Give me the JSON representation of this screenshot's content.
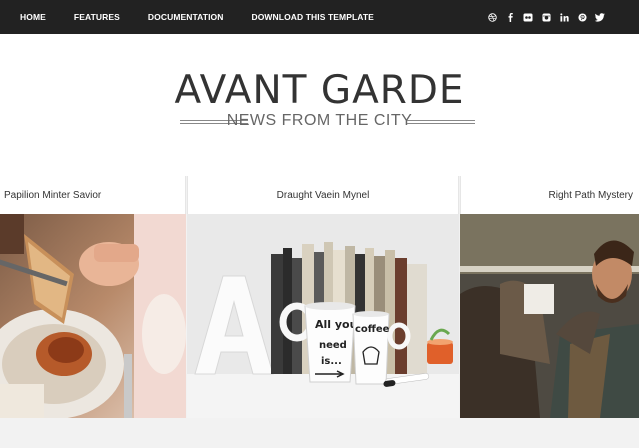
{
  "nav": {
    "items": [
      "HOME",
      "FEATURES",
      "DOCUMENTATION",
      "DOWNLOAD THIS TEMPLATE"
    ]
  },
  "social": {
    "icons": [
      "dribbble-icon",
      "facebook-icon",
      "flickr-icon",
      "instagram-icon",
      "linkedin-icon",
      "pinterest-icon",
      "twitter-icon"
    ]
  },
  "site": {
    "title": "AVANT GARDE",
    "tagline": "NEWS FROM THE CITY"
  },
  "slides": [
    {
      "title": "Papilion Minter Savior"
    },
    {
      "title": "Draught Vaein Mynel"
    },
    {
      "title": "Right Path Mystery"
    }
  ],
  "mugs": {
    "left_text_1": "All you",
    "left_text_2": "need",
    "left_text_3": "is...",
    "right_text": "coffee"
  },
  "colors": {
    "topbar": "#222222",
    "accent": "#333333"
  }
}
